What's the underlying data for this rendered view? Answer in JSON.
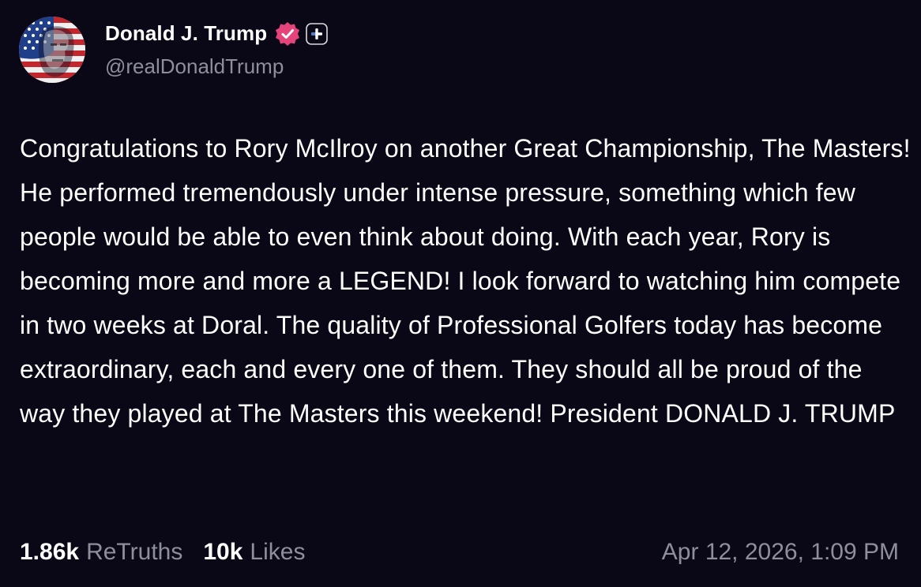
{
  "author": {
    "display_name": "Donald J. Trump",
    "handle": "@realDonaldTrump",
    "avatar_icon": "flag-portrait-avatar",
    "verified_icon": "verified-badge-icon",
    "verified_color": "#e5447b",
    "plus_icon": "plus-icon"
  },
  "post": {
    "text": "Congratulations to Rory McIlroy on another Great Championship, The Masters! He performed tremendously under intense pressure, something which few people would be able to even think about doing. With each year, Rory is becoming more and more a LEGEND! I look forward to watching him compete in two weeks at Doral. The quality of Professional Golfers today has become extraordinary, each and every one of them. They should all be proud of the way they played at The Masters this weekend! President DONALD J. TRUMP",
    "timestamp": "Apr 12, 2026, 1:09 PM"
  },
  "stats": {
    "retruths_count": "1.86k",
    "retruths_label": "ReTruths",
    "likes_count": "10k",
    "likes_label": "Likes"
  },
  "colors": {
    "background": "#0a0817",
    "text": "#ffffff",
    "muted": "#8f8e9c"
  }
}
